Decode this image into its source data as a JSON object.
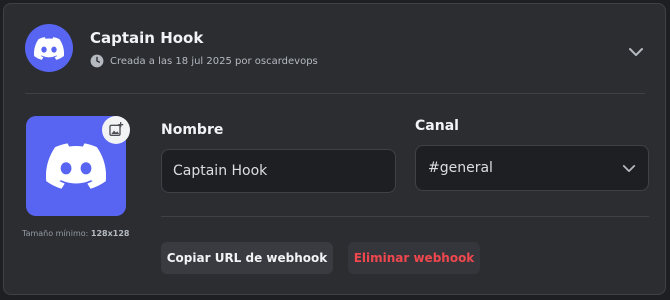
{
  "webhook": {
    "name": "Captain Hook",
    "created_text": "Creada a las 18 jul 2025 por oscardevops"
  },
  "avatar_section": {
    "min_size_label": "Tamaño mínimo:",
    "min_size_value": "128x128"
  },
  "form": {
    "name_label": "Nombre",
    "name_value": "Captain Hook",
    "channel_label": "Canal",
    "channel_value": "#general"
  },
  "actions": {
    "copy_label": "Copiar URL de webhook",
    "delete_label": "Eliminar webhook"
  },
  "colors": {
    "brand": "#5865f2",
    "danger": "#f0474d",
    "card_bg": "#2b2d31"
  },
  "icons": {
    "avatar": "discord-logo-icon",
    "clock": "clock-icon",
    "collapse": "chevron-down-icon",
    "upload": "image-add-icon",
    "select": "chevron-down-icon"
  }
}
